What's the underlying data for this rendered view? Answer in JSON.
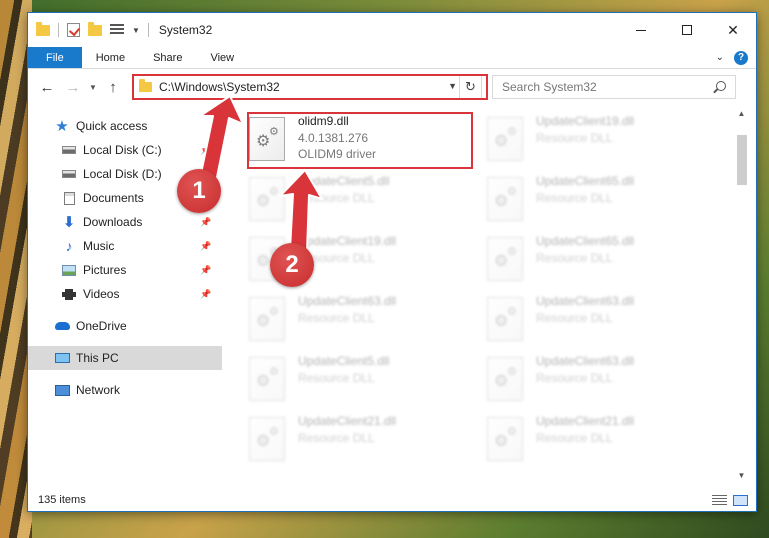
{
  "window": {
    "title": "System32"
  },
  "ribbon": {
    "tabs": [
      "File",
      "Home",
      "Share",
      "View"
    ]
  },
  "address": {
    "path": "C:\\Windows\\System32"
  },
  "search": {
    "placeholder": "Search System32"
  },
  "sidebar": {
    "items": [
      {
        "label": "Quick access"
      },
      {
        "label": "Local Disk (C:)"
      },
      {
        "label": "Local Disk (D:)"
      },
      {
        "label": "Documents"
      },
      {
        "label": "Downloads"
      },
      {
        "label": "Music"
      },
      {
        "label": "Pictures"
      },
      {
        "label": "Videos"
      },
      {
        "label": "OneDrive"
      },
      {
        "label": "This PC"
      },
      {
        "label": "Network"
      }
    ]
  },
  "file": {
    "name": "olidm9.dll",
    "version": "4.0.1381.276",
    "description": "OLIDM9 driver"
  },
  "ghost_files": [
    {
      "name": "UpdateClient19.dll",
      "type": "Resource DLL"
    },
    {
      "name": "UpdateClient5.dll",
      "type": "Resource DLL"
    },
    {
      "name": "UpdateClient65.dll",
      "type": "Resource DLL"
    },
    {
      "name": "UpdateClient19.dll",
      "type": "Resource DLL"
    },
    {
      "name": "UpdateClient65.dll",
      "type": "Resource DLL"
    },
    {
      "name": "UpdateClient63.dll",
      "type": "Resource DLL"
    },
    {
      "name": "UpdateClient63.dll",
      "type": "Resource DLL"
    },
    {
      "name": "UpdateClient5.dll",
      "type": "Resource DLL"
    },
    {
      "name": "UpdateClient63.dll",
      "type": "Resource DLL"
    },
    {
      "name": "UpdateClient21.dll",
      "type": "Resource DLL"
    },
    {
      "name": "UpdateClient21.dll",
      "type": "Resource DLL"
    }
  ],
  "status": {
    "item_count": "135 items"
  },
  "callouts": {
    "first": "1",
    "second": "2"
  },
  "colors": {
    "accent": "#1979ca",
    "highlight": "#d9343a",
    "selection": "#d9d9d9"
  }
}
